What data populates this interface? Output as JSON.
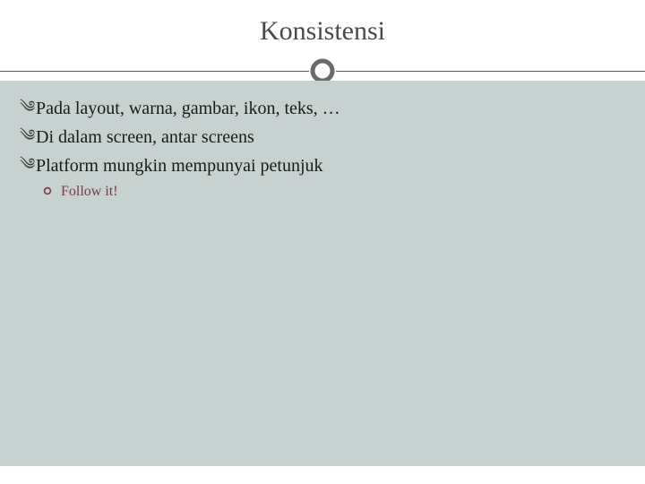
{
  "title": "Konsistensi",
  "bullets": [
    {
      "text": "Pada layout, warna, gambar, ikon, teks, …"
    },
    {
      "text": "Di dalam screen, antar screens"
    },
    {
      "text": "Platform mungkin mempunyai petunjuk"
    }
  ],
  "subbullets": [
    {
      "text": "Follow it!"
    }
  ],
  "colors": {
    "body_bg": "#c7d1d0",
    "sub_text": "#7a3a44"
  }
}
